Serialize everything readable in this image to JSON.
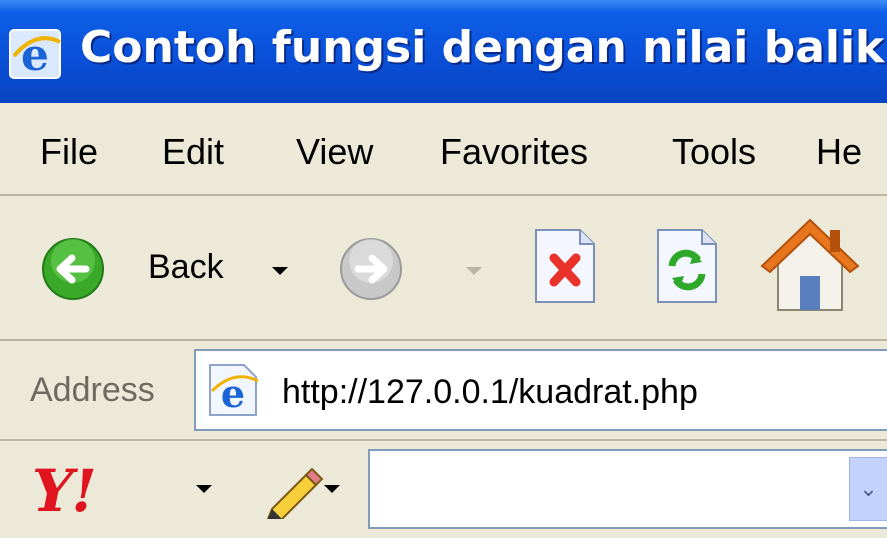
{
  "window": {
    "title": "Contoh fungsi dengan nilai balik -"
  },
  "menu": [
    "File",
    "Edit",
    "View",
    "Favorites",
    "Tools",
    "He"
  ],
  "toolbar": {
    "back_label": "Back",
    "icons": [
      "back-arrow-icon",
      "forward-arrow-icon",
      "stop-icon",
      "refresh-icon",
      "home-icon"
    ]
  },
  "address": {
    "label": "Address",
    "url": "http://127.0.0.1/kuadrat.php"
  },
  "yahoo": {
    "logo": "Y!",
    "search_value": ""
  },
  "colors": {
    "titlebar": "#0a50d8",
    "chrome": "#ece9d8",
    "field_border": "#7f9db9",
    "yahoo_red": "#e0141e"
  }
}
